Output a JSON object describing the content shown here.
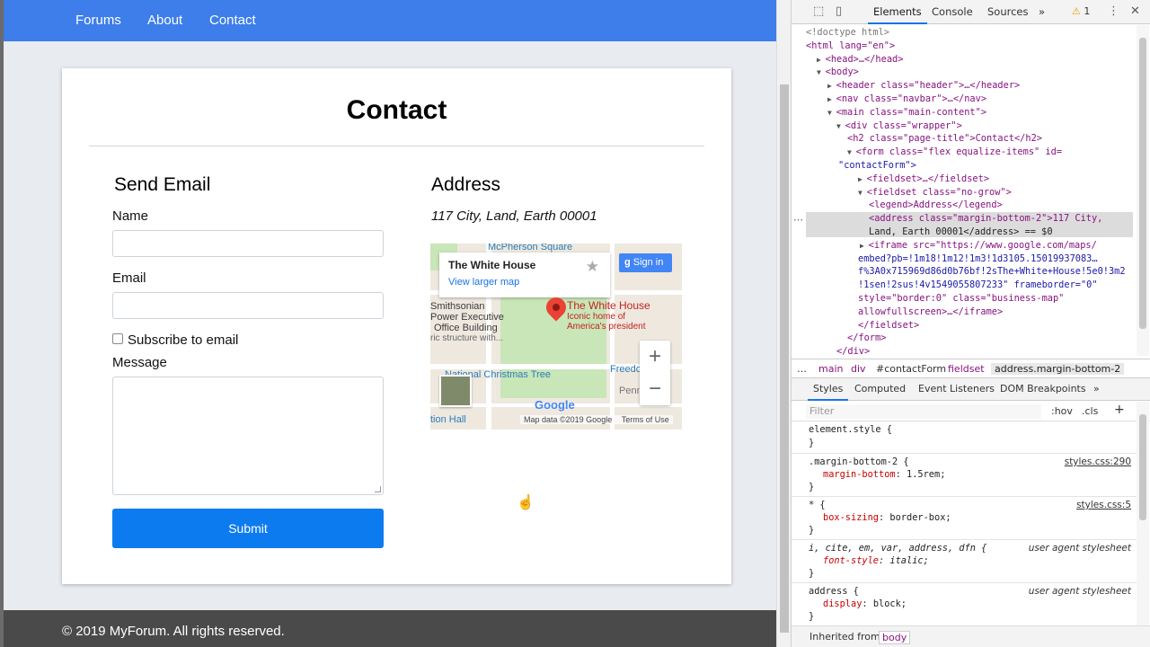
{
  "nav": {
    "items": [
      "Forums",
      "About",
      "Contact"
    ]
  },
  "page": {
    "title": "Contact"
  },
  "form": {
    "legend": "Send Email",
    "name_label": "Name",
    "email_label": "Email",
    "subscribe_label": "Subscribe to email",
    "message_label": "Message",
    "submit_label": "Submit"
  },
  "address": {
    "legend": "Address",
    "text": "117 City, Land, Earth 00001"
  },
  "map": {
    "place_title": "The White House",
    "larger_map": "View larger map",
    "signin": "Sign in",
    "pin_title": "The White House",
    "pin_sub1": "Iconic home of",
    "pin_sub2": "America's president",
    "labels": {
      "mcpherson": "McPherson Square",
      "smithsonian": "Smithsonian",
      "powerexec": "Power Executive",
      "office": "Office Building",
      "historic": "ric structure with...",
      "nct": "National Christmas Tree",
      "freedom": "Freedom P",
      "penn": "Penn",
      "nationhall": "tion Hall"
    },
    "google": "Google",
    "footer_data": "Map data ©2019 Google",
    "footer_terms": "Terms of Use",
    "zoom_in": "+",
    "zoom_out": "−"
  },
  "footer": {
    "text": "© 2019 MyForum. All rights reserved."
  },
  "devtools": {
    "tabs": [
      "Elements",
      "Console",
      "Sources",
      "»"
    ],
    "warn_count": "1",
    "tree": [
      {
        "t": "<!doctype html>"
      },
      {
        "t": "<html lang=\"en\">"
      },
      {
        "t": "<head>…</head>"
      },
      {
        "t": "<body>"
      },
      {
        "t": "<header class=\"header\">…</header>"
      },
      {
        "t": "<nav class=\"navbar\">…</nav>"
      },
      {
        "t": "<main class=\"main-content\">"
      },
      {
        "t": "<div class=\"wrapper\">"
      },
      {
        "t": "<h2 class=\"page-title\">Contact</h2>"
      },
      {
        "t": "<form class=\"flex equalize-items\" id="
      },
      {
        "t": "\"contactForm\">"
      },
      {
        "t": "<fieldset>…</fieldset>"
      },
      {
        "t": "<fieldset class=\"no-grow\">"
      },
      {
        "t": "<legend>Address</legend>"
      },
      {
        "t": "<address class=\"margin-bottom-2\">117 City,"
      },
      {
        "t": "Land, Earth 00001</address> == $0"
      },
      {
        "t": "<iframe src=\"https://www.google.com/maps/"
      },
      {
        "t": "embed?pb=!1m18!1m12!1m3!1d3105.15019937083…"
      },
      {
        "t": "f%3A0x715969d86d0b76bf!2sThe+White+House!5e0!3m2"
      },
      {
        "t": "!1sen!2sus!4v1549055807233\" frameborder=\"0\""
      },
      {
        "t": "style=\"border:0\" class=\"business-map\""
      },
      {
        "t": "allowfullscreen>…</iframe>"
      },
      {
        "t": "</fieldset>"
      },
      {
        "t": "</form>"
      },
      {
        "t": "</div>"
      }
    ],
    "breadcrumbs": [
      "…",
      "main",
      "div",
      "#contactForm",
      "fieldset",
      "address.margin-bottom-2"
    ],
    "subtabs": [
      "Styles",
      "Computed",
      "Event Listeners",
      "DOM Breakpoints",
      "»"
    ],
    "filter_placeholder": "Filter",
    "hov": ":hov",
    "cls": ".cls",
    "add": "+",
    "rules": {
      "element_style": "element.style {",
      "close": "}",
      "mb_selector": ".margin-bottom-2 {",
      "mb_prop": "margin-bottom",
      "mb_val": "1.5rem;",
      "mb_src": "styles.css:290",
      "star_selector": "* {",
      "star_prop": "box-sizing",
      "star_val": "border-box;",
      "star_src": "styles.css:5",
      "italic_selector": "i, cite, em, var, address, dfn {",
      "italic_prop": "font-style",
      "italic_val": "italic;",
      "ua": "user agent stylesheet",
      "address_selector": "address {",
      "address_prop": "display",
      "address_val": "block;"
    },
    "inherited_label": "Inherited from",
    "inherited_tag": "body"
  }
}
